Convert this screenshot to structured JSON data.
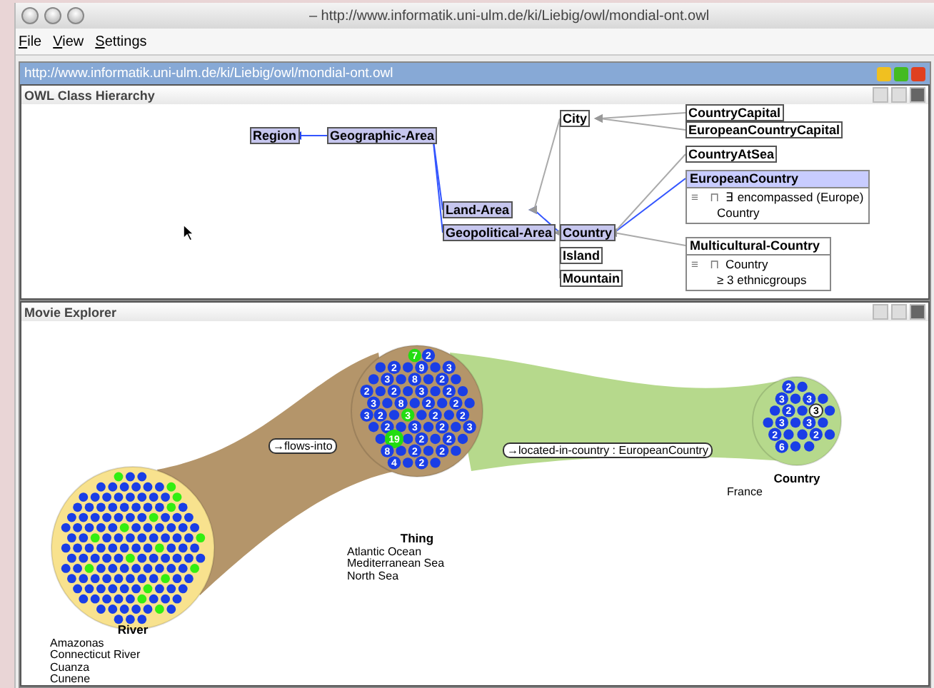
{
  "window": {
    "title": "– http://www.informatik.uni-ulm.de/ki/Liebig/owl/mondial-ont.owl"
  },
  "menu": [
    "File",
    "View",
    "Settings"
  ],
  "frame": {
    "title": "http://www.informatik.uni-ulm.de/ki/Liebig/owl/mondial-ont.owl"
  },
  "hierarchy": {
    "title": "OWL Class Hierarchy",
    "nodes": [
      {
        "label": "Region",
        "highlighted": true
      },
      {
        "label": "Geographic-Area",
        "highlighted": true
      },
      {
        "label": "Land-Area",
        "highlighted": true
      },
      {
        "label": "Geopolitical-Area",
        "highlighted": true
      },
      {
        "label": "City",
        "highlighted": false
      },
      {
        "label": "CountryCapital",
        "highlighted": false
      },
      {
        "label": "EuropeanCountryCapital",
        "highlighted": false
      },
      {
        "label": "CountryAtSea",
        "highlighted": false
      },
      {
        "label": "EuropeanCountry",
        "highlighted": true,
        "rows": [
          {
            "mark": "≡",
            "op": "⊓",
            "text": "∃ encompassed (Europe)"
          },
          {
            "text": "Country"
          }
        ]
      },
      {
        "label": "Multicultural-Country",
        "highlighted": false,
        "rows": [
          {
            "mark": "≡",
            "op": "⊓",
            "text": "Country"
          },
          {
            "text": "≥ 3 ethnicgroups"
          }
        ]
      },
      {
        "label": "Country",
        "highlighted": true
      },
      {
        "label": "Island",
        "highlighted": false
      },
      {
        "label": "Mountain",
        "highlighted": false
      }
    ]
  },
  "explorer": {
    "title": "Movie Explorer",
    "clusters": [
      {
        "name": "River",
        "color": "#f8e28e",
        "items": [
          "Amazonas",
          "Connecticut River",
          "Cuanza",
          "Cunene"
        ]
      },
      {
        "name": "Thing",
        "color": "#b4956a",
        "items": [
          "Atlantic Ocean",
          "Mediterranean Sea",
          "North Sea"
        ],
        "badges": [
          {
            "label": "7",
            "color": "#22dd11"
          },
          {
            "label": "2",
            "color": "#1a3ee6"
          },
          {
            "label": "2",
            "color": "#1a3ee6"
          },
          {
            "label": "9",
            "color": "#1a3ee6"
          },
          {
            "label": "3",
            "color": "#1a3ee6"
          },
          {
            "label": "3",
            "color": "#1a3ee6"
          },
          {
            "label": "8",
            "color": "#1a3ee6"
          },
          {
            "label": "2",
            "color": "#1a3ee6"
          },
          {
            "label": "2",
            "color": "#1a3ee6"
          },
          {
            "label": "2",
            "color": "#1a3ee6"
          },
          {
            "label": "3",
            "color": "#1a3ee6"
          },
          {
            "label": "2",
            "color": "#1a3ee6"
          },
          {
            "label": "3",
            "color": "#1a3ee6"
          },
          {
            "label": "8",
            "color": "#1a3ee6"
          },
          {
            "label": "2",
            "color": "#1a3ee6"
          },
          {
            "label": "2",
            "color": "#1a3ee6"
          },
          {
            "label": "3",
            "color": "#1a3ee6"
          },
          {
            "label": "2",
            "color": "#1a3ee6"
          },
          {
            "label": "3",
            "color": "#22dd11"
          },
          {
            "label": "2",
            "color": "#1a3ee6"
          },
          {
            "label": "2",
            "color": "#1a3ee6"
          },
          {
            "label": "2",
            "color": "#1a3ee6"
          },
          {
            "label": "3",
            "color": "#1a3ee6"
          },
          {
            "label": "2",
            "color": "#1a3ee6"
          },
          {
            "label": "3",
            "color": "#1a3ee6"
          },
          {
            "label": "19",
            "color": "#22dd11"
          },
          {
            "label": "2",
            "color": "#1a3ee6"
          },
          {
            "label": "2",
            "color": "#1a3ee6"
          },
          {
            "label": "8",
            "color": "#1a3ee6"
          },
          {
            "label": "2",
            "color": "#1a3ee6"
          },
          {
            "label": "2",
            "color": "#1a3ee6"
          },
          {
            "label": "4",
            "color": "#1a3ee6"
          },
          {
            "label": "2",
            "color": "#1a3ee6"
          }
        ]
      },
      {
        "name": "Country",
        "color": "#b6d98c",
        "items": [
          "France"
        ],
        "badges": [
          {
            "label": "2",
            "color": "#1a3ee6"
          },
          {
            "label": "3",
            "color": "#1a3ee6"
          },
          {
            "label": "3",
            "color": "#1a3ee6"
          },
          {
            "label": "2",
            "color": "#1a3ee6"
          },
          {
            "label": "3",
            "color": "#ffffff"
          },
          {
            "label": "3",
            "color": "#1a3ee6"
          },
          {
            "label": "3",
            "color": "#1a3ee6"
          },
          {
            "label": "2",
            "color": "#1a3ee6"
          },
          {
            "label": "2",
            "color": "#1a3ee6"
          },
          {
            "label": "6",
            "color": "#1a3ee6"
          }
        ]
      }
    ],
    "links": [
      {
        "label": "→flows-into"
      },
      {
        "label": "→located-in-country : EuropeanCountry"
      }
    ]
  }
}
